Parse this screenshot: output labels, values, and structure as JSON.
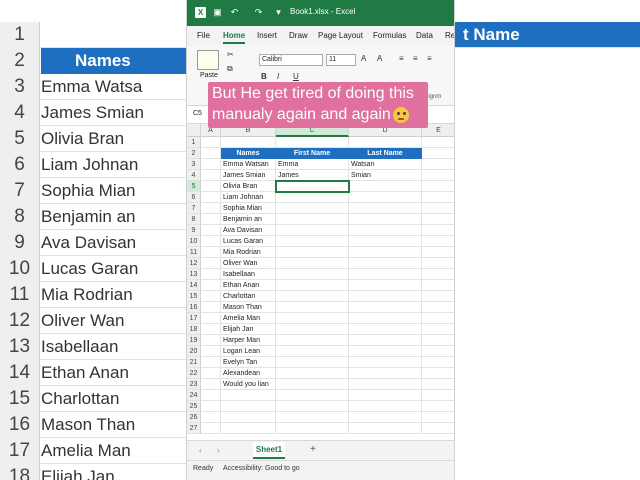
{
  "window": {
    "title": "Book1.xlsx - Excel",
    "brand_color": "#1f7a44"
  },
  "ribbon_tabs": [
    "File",
    "Home",
    "Insert",
    "Draw",
    "Page Layout",
    "Formulas",
    "Data",
    "Re"
  ],
  "active_tab": "Home",
  "ribbon": {
    "paste_label": "Paste",
    "font_name": "Calibri",
    "font_size": "11",
    "alignment_label": "Alignm"
  },
  "name_box": "C5",
  "columns": [
    "A",
    "B",
    "C",
    "D",
    "E"
  ],
  "selected_column": "C",
  "header_row": {
    "names": "Names",
    "first": "First Name",
    "last": "Last Name"
  },
  "rows": [
    {
      "num": "1",
      "name": "",
      "first": "",
      "last": ""
    },
    {
      "num": "2",
      "name": "Names",
      "first": "First Name",
      "last": "Last Name"
    },
    {
      "num": "3",
      "name": "Emma Watsan",
      "first": "Emma",
      "last": "Watsan"
    },
    {
      "num": "4",
      "name": "James Smian",
      "first": "James",
      "last": "Smian"
    },
    {
      "num": "5",
      "name": "Olivia Bran",
      "first": "",
      "last": ""
    },
    {
      "num": "6",
      "name": "Liam Johnan",
      "first": "",
      "last": ""
    },
    {
      "num": "7",
      "name": "Sophia Mian",
      "first": "",
      "last": ""
    },
    {
      "num": "8",
      "name": "Benjamin an",
      "first": "",
      "last": ""
    },
    {
      "num": "9",
      "name": "Ava Davisan",
      "first": "",
      "last": ""
    },
    {
      "num": "10",
      "name": "Lucas Garan",
      "first": "",
      "last": ""
    },
    {
      "num": "11",
      "name": "Mia Rodrian",
      "first": "",
      "last": ""
    },
    {
      "num": "12",
      "name": "Oliver Wan",
      "first": "",
      "last": ""
    },
    {
      "num": "13",
      "name": "Isabellaan",
      "first": "",
      "last": ""
    },
    {
      "num": "14",
      "name": "Ethan Anan",
      "first": "",
      "last": ""
    },
    {
      "num": "15",
      "name": "Charlottan",
      "first": "",
      "last": ""
    },
    {
      "num": "16",
      "name": "Mason Than",
      "first": "",
      "last": ""
    },
    {
      "num": "17",
      "name": "Amelia Man",
      "first": "",
      "last": ""
    },
    {
      "num": "18",
      "name": "Elijah Jan",
      "first": "",
      "last": ""
    },
    {
      "num": "19",
      "name": "Harper Man",
      "first": "",
      "last": ""
    },
    {
      "num": "20",
      "name": "Logan Lean",
      "first": "",
      "last": ""
    },
    {
      "num": "21",
      "name": "Evelyn Tan",
      "first": "",
      "last": ""
    },
    {
      "num": "22",
      "name": "Alexandean",
      "first": "",
      "last": ""
    },
    {
      "num": "23",
      "name": "Would you lian",
      "first": "",
      "last": ""
    },
    {
      "num": "24",
      "name": "",
      "first": "",
      "last": ""
    },
    {
      "num": "25",
      "name": "",
      "first": "",
      "last": ""
    },
    {
      "num": "26",
      "name": "",
      "first": "",
      "last": ""
    },
    {
      "num": "27",
      "name": "",
      "first": "",
      "last": ""
    }
  ],
  "sheet_tab": "Sheet1",
  "status": {
    "ready": "Ready",
    "accessibility": "Accessibility: Good to go"
  },
  "caption": "But He get tired of doing this manualy again and again",
  "background_left": {
    "row_numbers": [
      "1",
      "2",
      "3",
      "4",
      "5",
      "6",
      "7",
      "8",
      "9",
      "10",
      "11",
      "12",
      "13",
      "14",
      "15",
      "16",
      "17",
      "18"
    ],
    "cells": [
      "",
      "Names",
      "Emma Watsa",
      "James Smian",
      "Olivia Bran",
      "Liam Johnan",
      "Sophia Mian",
      "Benjamin an",
      "Ava Davisan",
      "Lucas Garan",
      "Mia Rodrian",
      "Oliver Wan",
      "Isabellaan",
      "Ethan Anan",
      "Charlottan",
      "Mason Than",
      "Amelia Man",
      "Elijah Jan"
    ]
  },
  "background_right": {
    "header": "t Name"
  }
}
